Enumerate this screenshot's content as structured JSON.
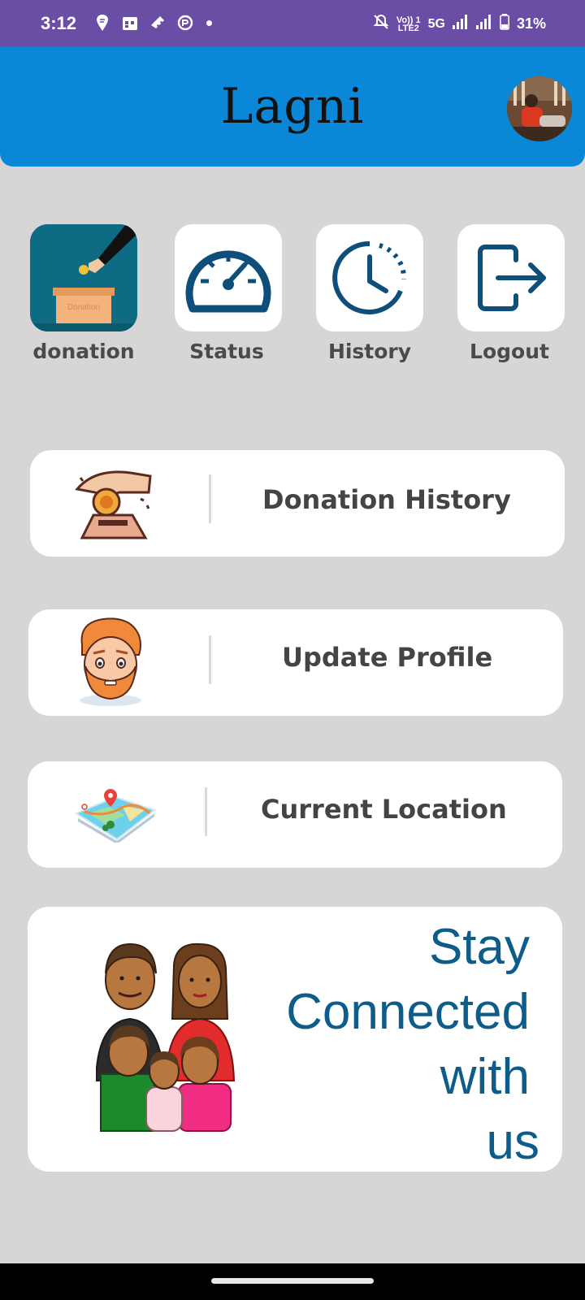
{
  "status_bar": {
    "time": "3:12",
    "net_label_top": "Vo)) 1",
    "net_label_bottom": "LTE2",
    "net_5g": "5G",
    "battery": "31%"
  },
  "header": {
    "title": "Lagni"
  },
  "quick_actions": [
    {
      "label": "donation",
      "icon": "donation-box-icon"
    },
    {
      "label": "Status",
      "icon": "speedometer-icon"
    },
    {
      "label": "History",
      "icon": "clock-history-icon"
    },
    {
      "label": "Logout",
      "icon": "logout-icon"
    }
  ],
  "cards": {
    "donation_history": "Donation History",
    "update_profile": "Update Profile",
    "current_location": "Current Location"
  },
  "stay_connected": {
    "line1": "Stay",
    "line2": "Connected",
    "line3": "with",
    "line4": "us"
  },
  "colors": {
    "status_bar": "#6a4ea6",
    "header": "#0a88d7",
    "background": "#d6d6d6",
    "icon_navy": "#0d4f7a",
    "stay_text": "#0d5c8a"
  }
}
